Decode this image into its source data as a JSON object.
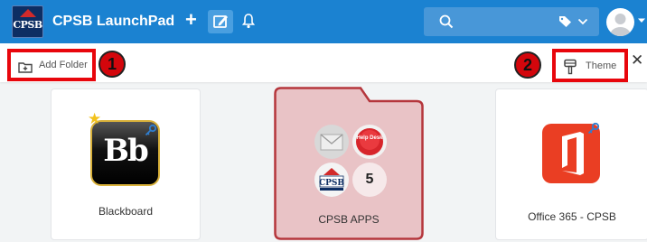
{
  "header": {
    "logo_text": "CPSB",
    "title": "CPSB LaunchPad"
  },
  "toolbar": {
    "add_folder_label": "Add Folder",
    "theme_label": "Theme",
    "close_glyph": "✕"
  },
  "annotations": [
    {
      "number": "1"
    },
    {
      "number": "2"
    }
  ],
  "tiles": [
    {
      "name": "Blackboard",
      "logo_text": "Bb",
      "starred": true
    },
    {
      "name": "CPSB APPS",
      "type": "folder",
      "mini_icons": [
        "mail",
        "help-desk",
        "cpsb"
      ],
      "more_count": "5",
      "help_desk_text": "Help Desk",
      "cpsb_text": "CPSB"
    },
    {
      "name": "Office 365 - CPSB"
    }
  ],
  "colors": {
    "header_bg": "#1b82d1",
    "highlight_border": "#e8060c",
    "folder_bg": "#e9c3c6",
    "folder_border": "#b5363c",
    "office_orange": "#ea3e23"
  }
}
